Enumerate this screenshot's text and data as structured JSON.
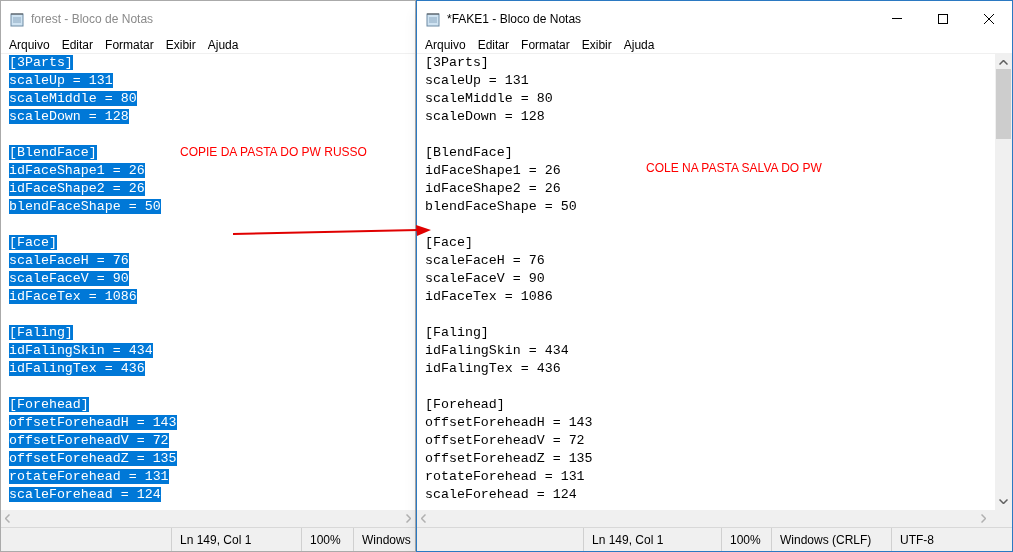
{
  "windows": [
    {
      "title": "forest - Bloco de Notas",
      "active": false,
      "text_selected": true,
      "menu": [
        "Arquivo",
        "Editar",
        "Formatar",
        "Exibir",
        "Ajuda"
      ],
      "sections": [
        {
          "header": "[3Parts]",
          "entries": [
            "scaleUp = 131",
            "scaleMiddle = 80",
            "scaleDown = 128"
          ]
        },
        {
          "header": "[BlendFace]",
          "entries": [
            "idFaceShape1 = 26",
            "idFaceShape2 = 26",
            "blendFaceShape = 50"
          ]
        },
        {
          "header": "[Face]",
          "entries": [
            "scaleFaceH = 76",
            "scaleFaceV = 90",
            "idFaceTex = 1086"
          ]
        },
        {
          "header": "[Faling]",
          "entries": [
            "idFalingSkin = 434",
            "idFalingTex = 436"
          ]
        },
        {
          "header": "[Forehead]",
          "entries": [
            "offsetForeheadH = 143",
            "offsetForeheadV = 72",
            "offsetForeheadZ = 135",
            "rotateForehead = 131",
            "scaleForehead = 124"
          ]
        }
      ],
      "status": [
        "Ln 149, Col 1",
        "100%",
        "Windows"
      ]
    },
    {
      "title": "*FAKE1 - Bloco de Notas",
      "active": true,
      "text_selected": false,
      "menu": [
        "Arquivo",
        "Editar",
        "Formatar",
        "Exibir",
        "Ajuda"
      ],
      "sections": [
        {
          "header": "[3Parts]",
          "entries": [
            "scaleUp = 131",
            "scaleMiddle = 80",
            "scaleDown = 128"
          ]
        },
        {
          "header": "[BlendFace]",
          "entries": [
            "idFaceShape1 = 26",
            "idFaceShape2 = 26",
            "blendFaceShape = 50"
          ]
        },
        {
          "header": "[Face]",
          "entries": [
            "scaleFaceH = 76",
            "scaleFaceV = 90",
            "idFaceTex = 1086"
          ]
        },
        {
          "header": "[Faling]",
          "entries": [
            "idFalingSkin = 434",
            "idFalingTex = 436"
          ]
        },
        {
          "header": "[Forehead]",
          "entries": [
            "offsetForeheadH = 143",
            "offsetForeheadV = 72",
            "offsetForeheadZ = 135",
            "rotateForehead = 131",
            "scaleForehead = 124"
          ]
        }
      ],
      "status": [
        "Ln 149, Col 1",
        "100%",
        "Windows (CRLF)",
        "UTF-8"
      ]
    }
  ],
  "annotations": [
    "COPIE DA PASTA DO PW RUSSO",
    "COLE NA PASTA SALVA DO PW"
  ]
}
